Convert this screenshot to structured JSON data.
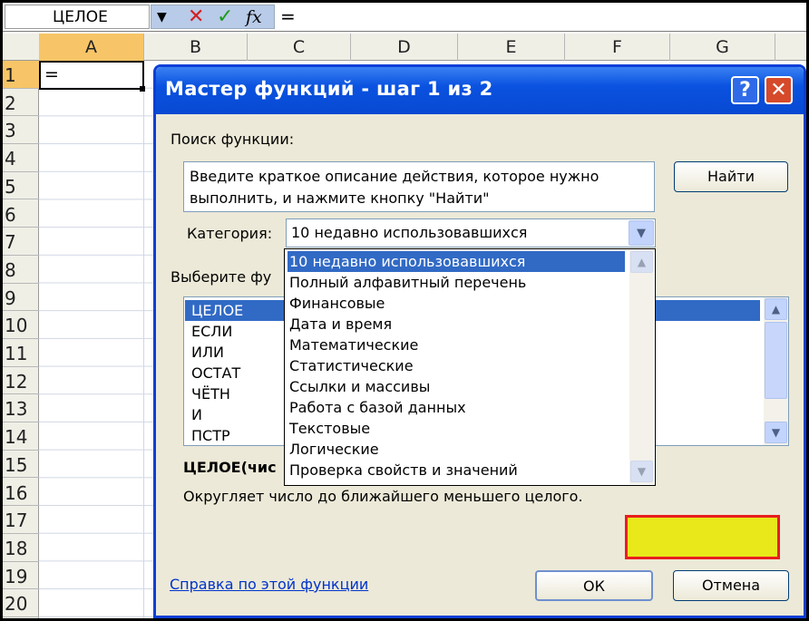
{
  "formula_bar": {
    "name_box": "ЦЕЛОЕ",
    "cancel_symbol": "✕",
    "enter_symbol": "✓",
    "fx_symbol": "fx",
    "formula": "="
  },
  "columns": [
    "A",
    "B",
    "C",
    "D",
    "E",
    "F",
    "G"
  ],
  "rows": [
    "1",
    "2",
    "3",
    "4",
    "5",
    "6",
    "7",
    "8",
    "9",
    "10",
    "11",
    "12",
    "13",
    "14",
    "15",
    "16",
    "17",
    "18",
    "19",
    "20"
  ],
  "cell_a1": "=",
  "dialog": {
    "title": "Мастер функций - шаг 1 из 2",
    "help_symbol": "?",
    "close_symbol": "✕",
    "search_label": "Поиск функции:",
    "search_text": "Введите краткое описание действия, которое нужно выполнить, и нажмите кнопку \"Найти\"",
    "find_button": "Найти",
    "category_label": "Категория:",
    "category_value": "10 недавно использовавшихся",
    "select_label": "Выберите фу",
    "functions": [
      "ЦЕЛОЕ",
      "ЕСЛИ",
      "ИЛИ",
      "ОСТАТ",
      "ЧЁТН",
      "И",
      "ПСТР"
    ],
    "signature": "ЦЕЛОЕ(чис",
    "description": "Округляет число до ближайшего меньшего целого.",
    "help_link": "Справка по этой функции",
    "ok_button": "ОК",
    "cancel_button": "Отмена",
    "highlight_color": "#e8e81a",
    "highlight_border": "#e81e1e"
  },
  "category_options": [
    "10 недавно использовавшихся",
    "Полный алфавитный перечень",
    "Финансовые",
    "Дата и время",
    "Математические",
    "Статистические",
    "Ссылки и массивы",
    "Работа с базой данных",
    "Текстовые",
    "Логические",
    "Проверка свойств и значений"
  ],
  "icons": {
    "dropdown_arrow": "chevron-down-icon",
    "scroll_up": "chevron-up-icon",
    "scroll_down": "chevron-down-icon"
  }
}
